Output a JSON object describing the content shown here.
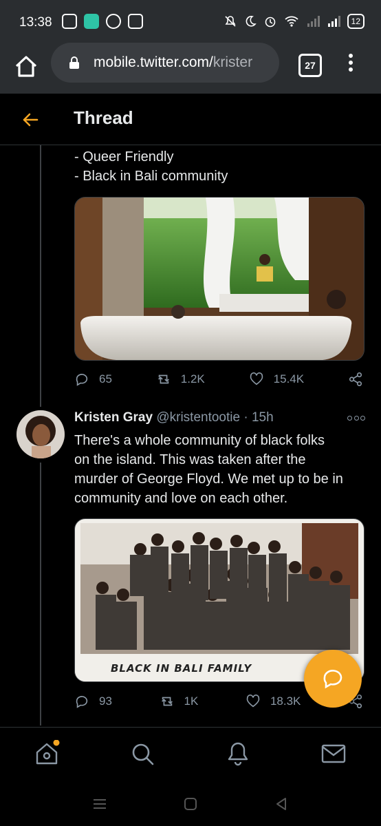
{
  "status_bar": {
    "time": "13:38",
    "battery": "12"
  },
  "browser": {
    "url_host": "mobile.twitter.com/",
    "url_path": "krister",
    "tab_count": "27"
  },
  "header": {
    "title": "Thread"
  },
  "tweet1": {
    "lines": [
      "- Queer Friendly",
      "- Black in Bali community"
    ],
    "replies": "65",
    "retweets": "1.2K",
    "likes": "15.4K"
  },
  "tweet2": {
    "name": "Kristen Gray",
    "handle": "@kristentootie",
    "separator": " · ",
    "time": "15h",
    "text_lines": [
      "There's a whole community of black folks",
      "on the island. This was taken after the",
      "murder of George Floyd. We met up to be in",
      "community and love on each other."
    ],
    "image_caption": "BLACK IN BALI FAMILY",
    "replies": "93",
    "retweets": "1K",
    "likes": "18.3K"
  },
  "colors": {
    "accent": "#f5a623",
    "background": "#000000",
    "secondary_text": "#8b98a5",
    "chrome": "#2a2d30"
  },
  "icons": {
    "back": "back-arrow-icon",
    "reply": "reply-icon",
    "retweet": "retweet-icon",
    "like": "heart-icon",
    "share": "share-icon",
    "home": "home-icon",
    "search": "search-icon",
    "notifications": "bell-icon",
    "messages": "mail-icon",
    "compose": "compose-reply-icon"
  }
}
